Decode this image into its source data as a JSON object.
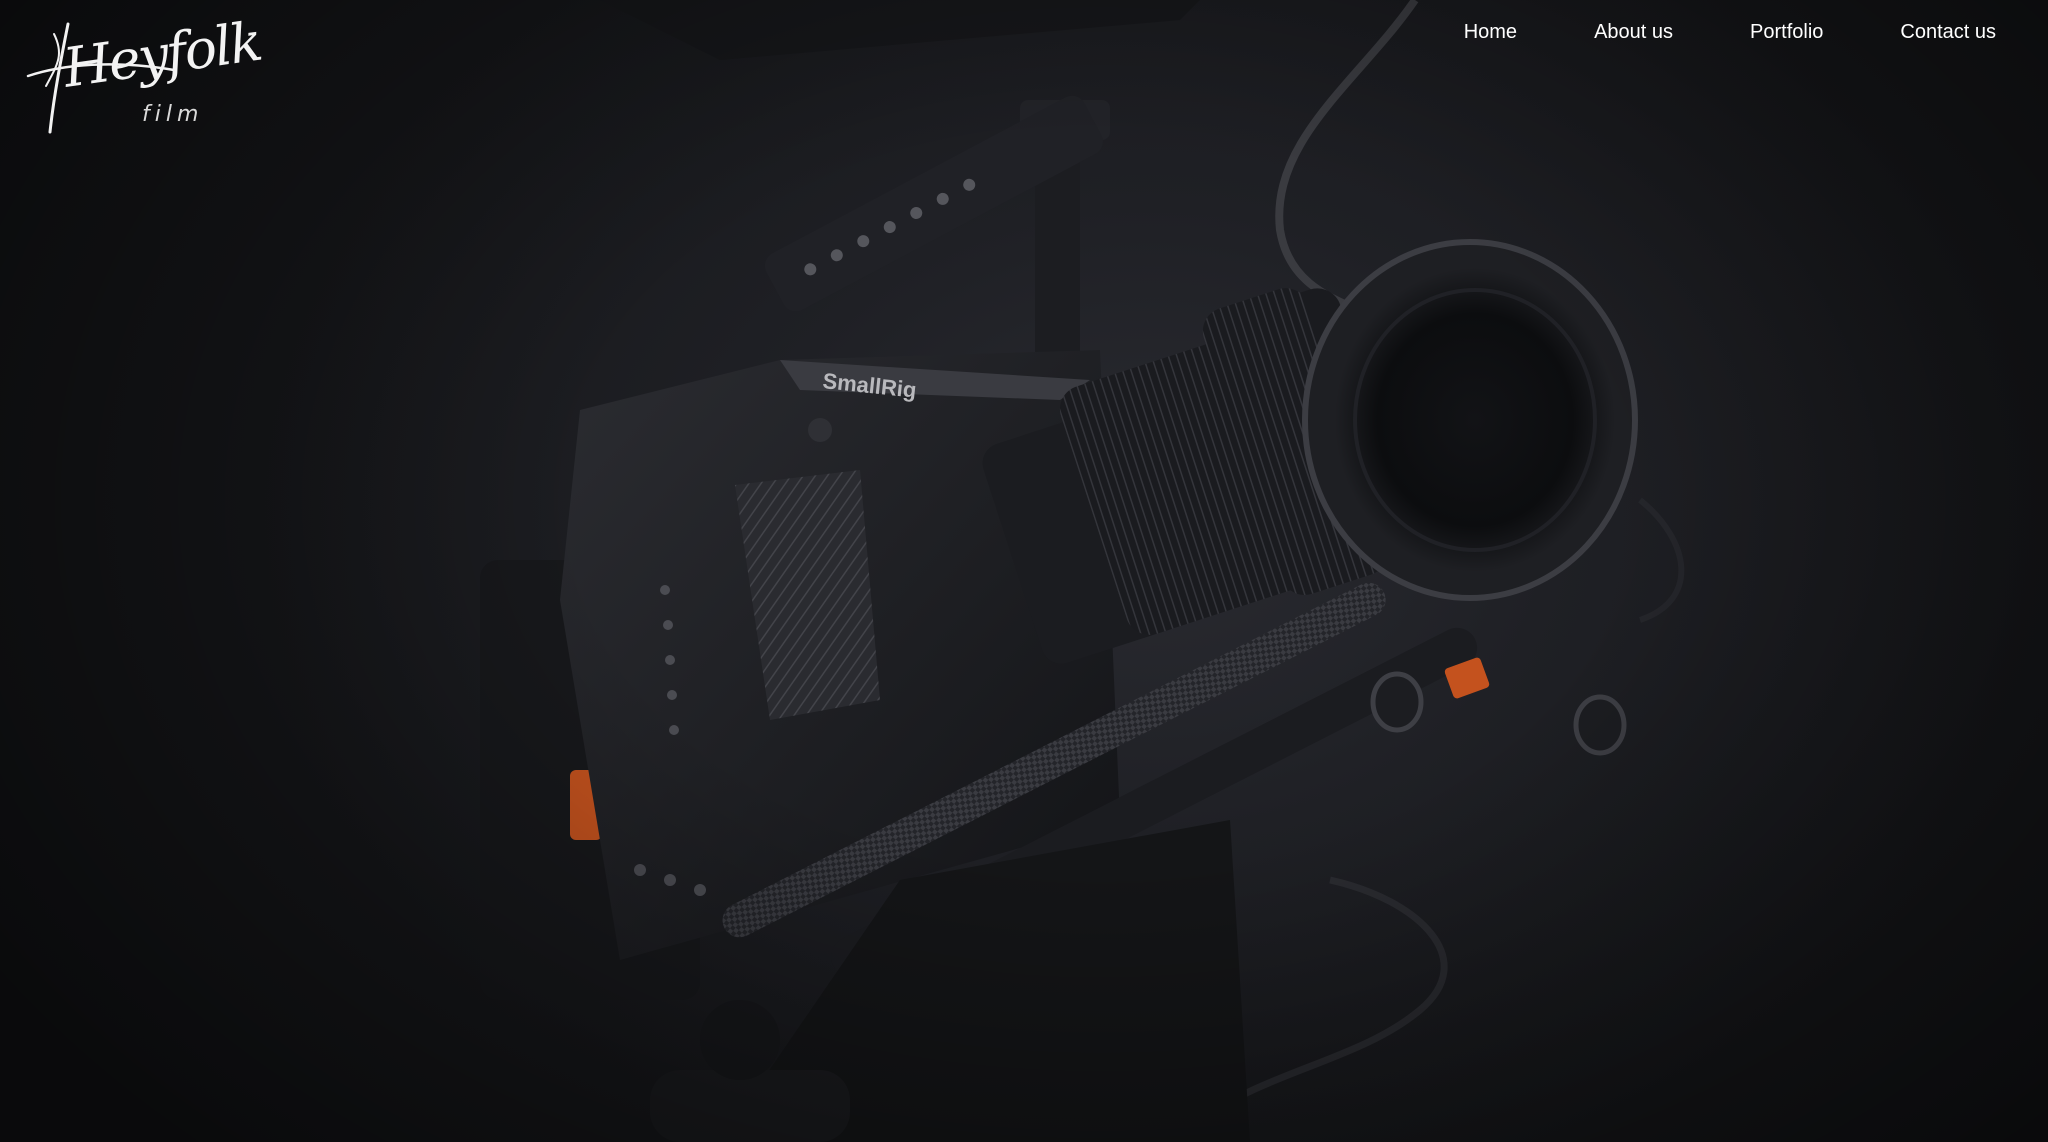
{
  "brand": {
    "logo_script": "Heyfolk",
    "logo_sub": "film"
  },
  "nav": {
    "items": [
      {
        "label": "Home"
      },
      {
        "label": "About us"
      },
      {
        "label": "Portfolio"
      },
      {
        "label": "Contact us"
      }
    ]
  },
  "hero": {
    "rig_brand": "SmallRig",
    "colors": {
      "background": "#1b1c20",
      "accent_orange": "#c4521e",
      "nav_text": "#ffffff"
    }
  }
}
